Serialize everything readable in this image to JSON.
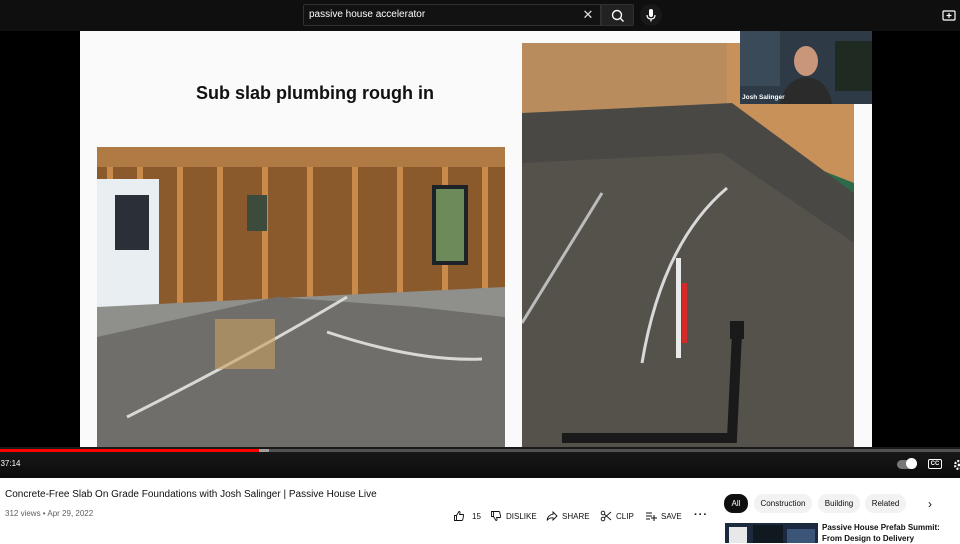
{
  "search": {
    "query": "passive house accelerator"
  },
  "player": {
    "slide_title": "Sub slab plumbing rough in",
    "webcam_name": "Josh Salinger",
    "time": "/ 37:14",
    "progress_percent": 27,
    "buffer_percent": 28,
    "cc_label": "CC"
  },
  "video": {
    "title": "Concrete-Free Slab On Grade Foundations with Josh Salinger | Passive House Live",
    "meta": "312 views • Apr 29, 2022",
    "actions": {
      "like_count": "15",
      "dislike": "DISLIKE",
      "share": "SHARE",
      "clip": "CLIP",
      "save": "SAVE"
    }
  },
  "chips": [
    "All",
    "Construction",
    "Building",
    "Related"
  ],
  "recommendation": {
    "title": "Passive House Prefab Summit: From Design to Delivery"
  },
  "colors": {
    "accent": "#ff0000",
    "topbar": "#0f0f0f",
    "chip_active": "#0f0f0f"
  }
}
